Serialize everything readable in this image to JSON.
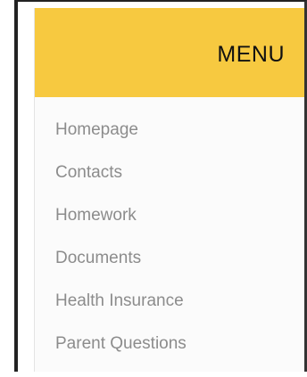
{
  "menu": {
    "title": "MENU",
    "header_color": "#f7c940",
    "items": [
      {
        "label": "Homepage"
      },
      {
        "label": "Contacts"
      },
      {
        "label": "Homework"
      },
      {
        "label": "Documents"
      },
      {
        "label": "Health Insurance"
      },
      {
        "label": "Parent Questions"
      }
    ]
  }
}
